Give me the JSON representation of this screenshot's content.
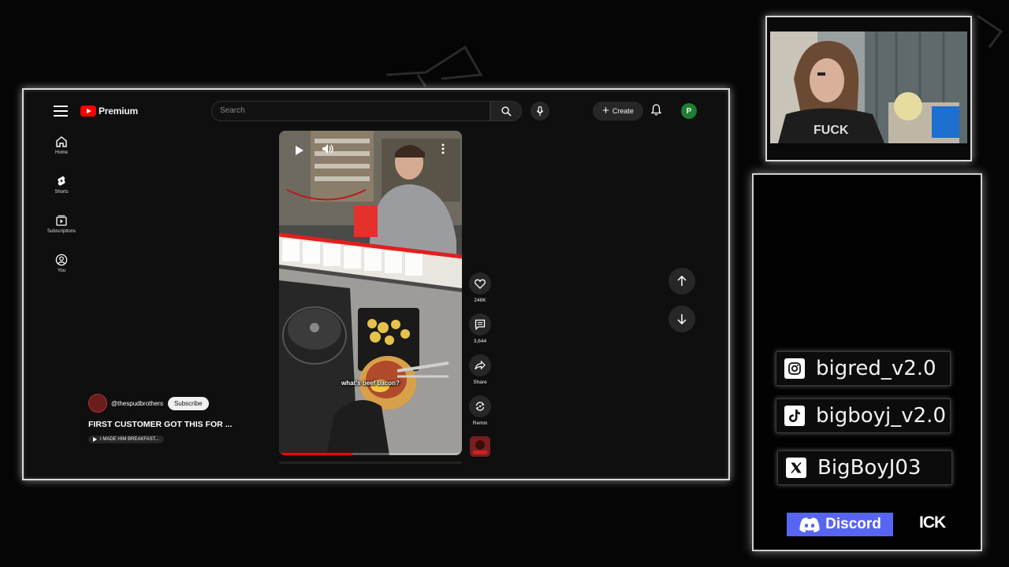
{
  "youtube": {
    "brand": "Premium",
    "search": {
      "placeholder": "Search"
    },
    "create_label": "Create",
    "avatar_letter": "P",
    "nav": [
      {
        "label": "Home",
        "icon": "home-icon"
      },
      {
        "label": "Shorts",
        "icon": "shorts-icon"
      },
      {
        "label": "Subscriptions",
        "icon": "subscriptions-icon"
      },
      {
        "label": "You",
        "icon": "you-icon"
      }
    ],
    "short": {
      "caption": "what's beef bacon?",
      "progress": 0.4,
      "likes": "248K",
      "comments": "3,644",
      "share_label": "Share",
      "remix_label": "Remix",
      "channel": "@thespudbrothers",
      "subscribe_label": "Subscribe",
      "title": "FIRST CUSTOMER GOT THIS FOR ...",
      "related": "I MADE HIM BREAKFAST..."
    }
  },
  "overlay": {
    "socials": [
      {
        "platform": "instagram",
        "icon": "instagram-icon",
        "handle": "bigred_v2.0"
      },
      {
        "platform": "tiktok",
        "icon": "tiktok-icon",
        "handle": "bigboyj_v2.0"
      },
      {
        "platform": "x",
        "icon": "x-logo-icon",
        "handle": "BigBoyJ03"
      }
    ],
    "discord_label": "Discord",
    "ick_label": "ICK"
  },
  "colors": {
    "youtube_red": "#ff0000",
    "discord": "#5865f2",
    "accent_green": "#1e7d32"
  }
}
